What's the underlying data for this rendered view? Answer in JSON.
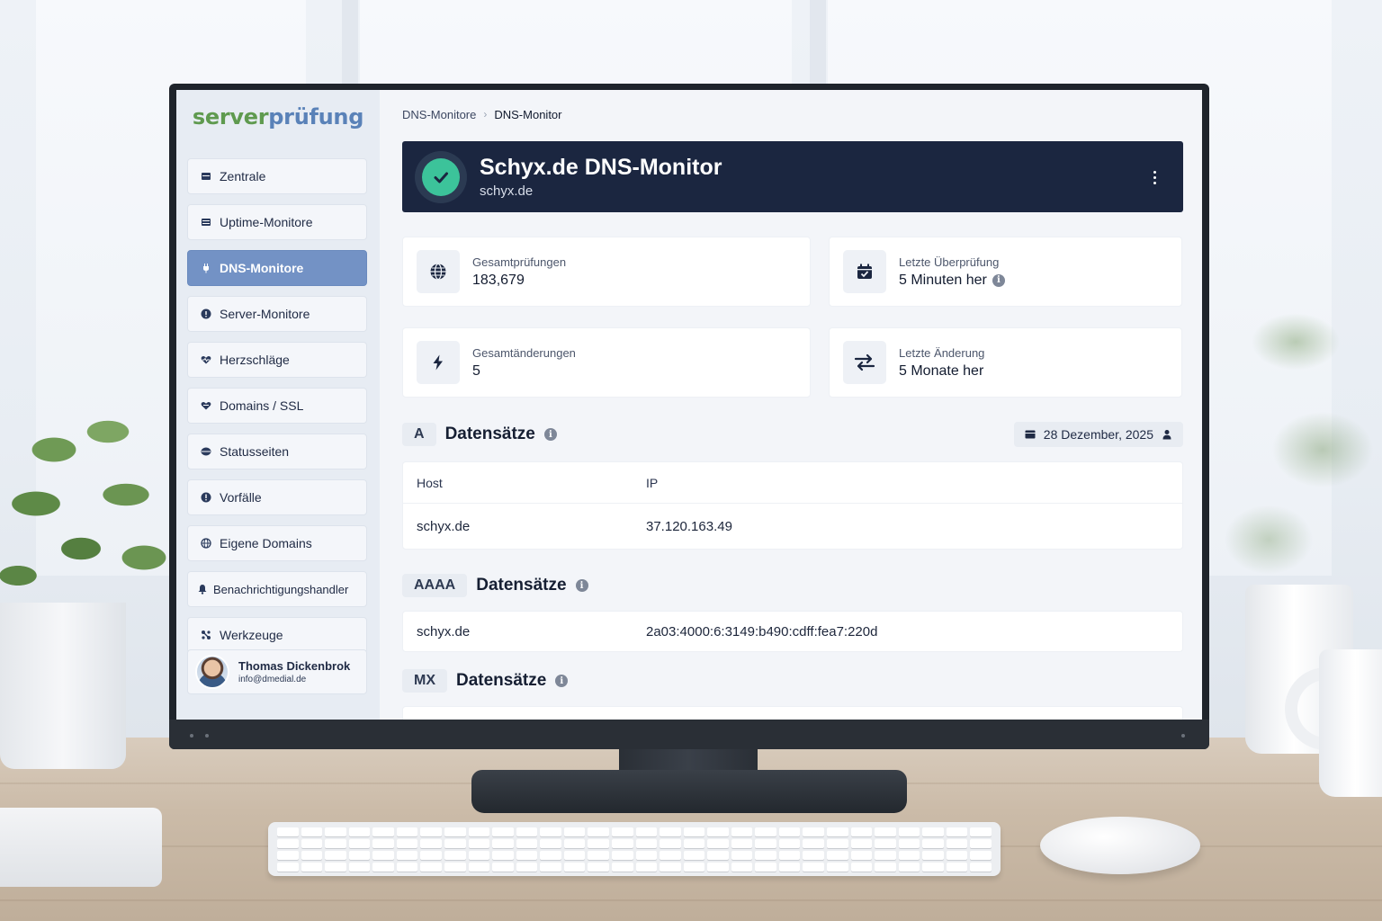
{
  "brand": {
    "part1": "server",
    "part2": "prüfung"
  },
  "colors": {
    "sidebar_active": "#7392c5",
    "hero_bg": "#1b2640",
    "status_ok": "#3cc39a",
    "brand_green": "#5f9a4f",
    "brand_blue": "#5a82b8"
  },
  "sidebar": {
    "items": [
      {
        "label": "Zentrale",
        "icon": "dashboard-icon"
      },
      {
        "label": "Uptime-Monitore",
        "icon": "monitor-icon"
      },
      {
        "label": "DNS-Monitore",
        "icon": "dns-icon",
        "active": true
      },
      {
        "label": "Server-Monitore",
        "icon": "server-icon"
      },
      {
        "label": "Herzschläge",
        "icon": "heartbeat-icon"
      },
      {
        "label": "Domains / SSL",
        "icon": "ssl-icon"
      },
      {
        "label": "Statusseiten",
        "icon": "status-page-icon"
      },
      {
        "label": "Vorfälle",
        "icon": "incident-icon"
      },
      {
        "label": "Eigene Domains",
        "icon": "globe-icon"
      },
      {
        "label": "Benachrichtigungshandler",
        "icon": "bell-icon"
      },
      {
        "label": "Werkzeuge",
        "icon": "tools-icon"
      }
    ],
    "user": {
      "name": "Thomas Dickenbrok",
      "email": "info@dmedial.de"
    }
  },
  "breadcrumb": {
    "parent": "DNS-Monitore",
    "separator": "›",
    "current": "DNS-Monitor"
  },
  "hero": {
    "title": "Schyx.de DNS-Monitor",
    "subtitle": "schyx.de",
    "status": "check-icon"
  },
  "stats": {
    "total_checks": {
      "label": "Gesamtprüfungen",
      "value": "183,679"
    },
    "last_check": {
      "label": "Letzte Überprüfung",
      "value": "5 Minuten her"
    },
    "total_changes": {
      "label": "Gesamtänderungen",
      "value": "5"
    },
    "last_change": {
      "label": "Letzte Änderung",
      "value": "5 Monate her"
    }
  },
  "records": {
    "a": {
      "type": "A",
      "title": "Datensätze",
      "date": "28 Dezember, 2025",
      "columns": [
        "Host",
        "IP"
      ],
      "rows": [
        {
          "host": "schyx.de",
          "value": "37.120.163.49"
        }
      ]
    },
    "aaaa": {
      "type": "AAAA",
      "title": "Datensätze",
      "rows": [
        {
          "host": "schyx.de",
          "value": "2a03:4000:6:3149:b490:cdff:fea7:220d"
        }
      ]
    },
    "mx": {
      "type": "MX",
      "title": "Datensätze"
    }
  },
  "info_glyph": "i"
}
